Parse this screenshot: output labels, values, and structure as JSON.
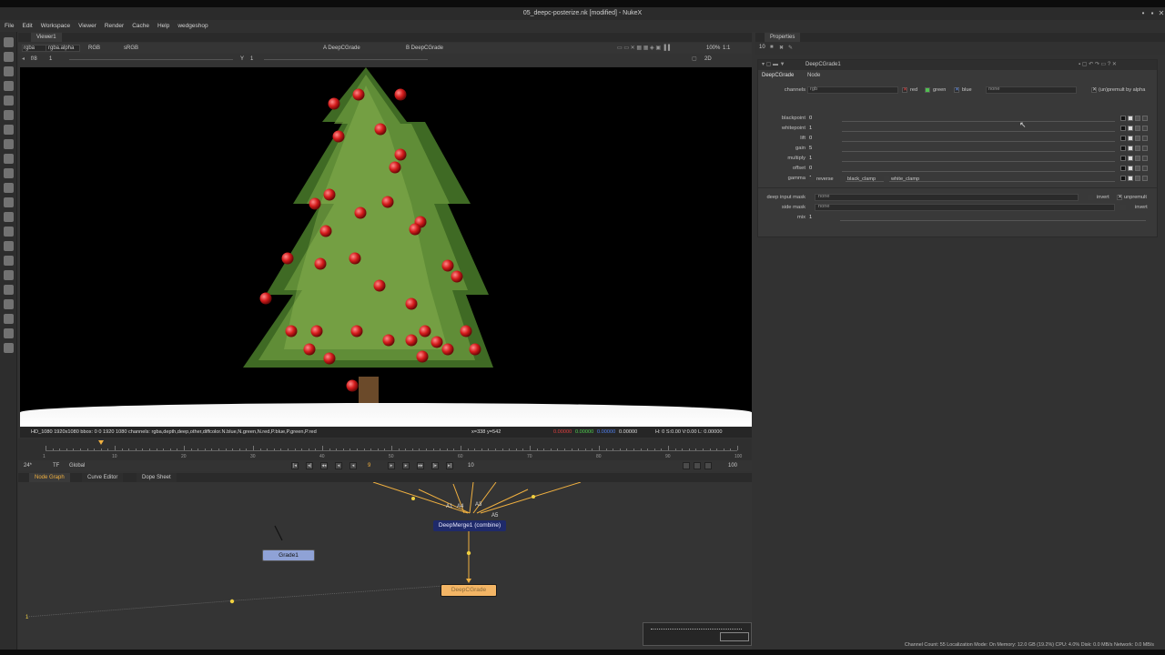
{
  "window": {
    "title": "05_deepc-posterize.nk [modified] - NukeX",
    "controls": [
      "•",
      "▪",
      "✕"
    ]
  },
  "menu": [
    "File",
    "Edit",
    "Workspace",
    "Viewer",
    "Render",
    "Cache",
    "Help",
    "wedgeshop"
  ],
  "viewer": {
    "tab_label": "Viewer1",
    "channels": "rgba",
    "alpha": "rgba.alpha",
    "colorspace_rgb": "RGB",
    "lut": "sRGB",
    "input_a": "A  DeepCGrade",
    "input_b": "B  DeepCGrade",
    "zoom": "100%",
    "ratio": "1:1",
    "mode_2d": "2D",
    "fstop": "f/8",
    "gain": "1",
    "gamma_label": "Y",
    "gamma": "1",
    "info_left": "HD_1080 1920x1080  bbox: 0 0 1920 1080 channels: rgba,depth,deep,other,diffcolor.N.blue,N.green,N.red,P.blue,P.green,P.red",
    "info_coords": "x=338 y=542",
    "info_rgb_r": "0.00000",
    "info_rgb_g": "0.00000",
    "info_rgb_b": "0.00000",
    "info_rgb_a": "0.00000",
    "info_hsv": "H:  0 S:0.00 V:0.00  L: 0.00000"
  },
  "timeline": {
    "fps": "24*",
    "tf": "TF",
    "scope": "Global",
    "ticks": [
      "1",
      "10",
      "20",
      "30",
      "40",
      "50",
      "60",
      "70",
      "80",
      "90",
      "100"
    ],
    "current_frame": "9",
    "end_frame": "100",
    "step": "10"
  },
  "nodegraph": {
    "tabs": [
      "Node Graph",
      "Curve Editor",
      "Dope Sheet"
    ],
    "nodes": {
      "grade": "Grade1",
      "merge": "DeepMerge1 (combine)",
      "deepcgrade": "DeepCGrade"
    },
    "input_labels": [
      "A1",
      "A4",
      "A3",
      "A5"
    ],
    "left_marker": "1"
  },
  "properties": {
    "tab_label": "Properties",
    "count": "10",
    "node_name": "DeepCGrade1",
    "tabs": [
      "DeepCGrade",
      "Node"
    ],
    "channels_label": "channels",
    "channels_value": "rgb",
    "red": "red",
    "green": "green",
    "blue": "blue",
    "channel_extra": "none",
    "unpremult_by": "(un)premult by alpha",
    "params": [
      {
        "label": "blackpoint",
        "value": "0"
      },
      {
        "label": "whitepoint",
        "value": "1"
      },
      {
        "label": "lift",
        "value": "0"
      },
      {
        "label": "gain",
        "value": "5"
      },
      {
        "label": "multiply",
        "value": "1"
      },
      {
        "label": "offset",
        "value": "0"
      },
      {
        "label": "gamma",
        "value": "1"
      }
    ],
    "reverse": "reverse",
    "black_clamp": "black_clamp",
    "white_clamp": "white_clamp",
    "deep_input_mask_label": "deep input mask",
    "deep_input_mask_value": "none",
    "invert": "invert",
    "unpremult": "unpremult",
    "side_mask_label": "side mask",
    "side_mask_value": "none",
    "mix_label": "mix",
    "mix_value": "1"
  },
  "status": "Channel Count: 55  Localization Mode: On  Memory: 12.0 GB (19.2%)  CPU: 4.0%  Disk: 0.0 MB/s  Network: 0.0 MB/s",
  "colors": {
    "accent_orange": "#f0b040",
    "merge_node": "#1f2a6a",
    "grade_node": "#8fa2d6",
    "deepcgrade_node": "#f3b565",
    "ornament": "#d42020"
  }
}
